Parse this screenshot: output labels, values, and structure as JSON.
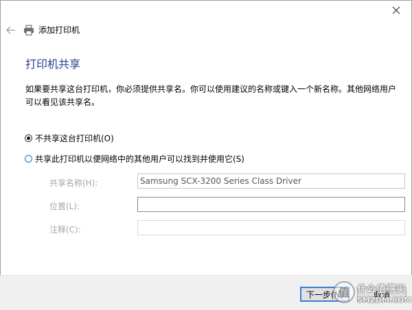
{
  "window": {
    "title": "添加打印机"
  },
  "page": {
    "heading": "打印机共享",
    "description": "如果要共享这台打印机，你必须提供共享名。你可以使用建议的名称或键入一个新名称。其他网络用户可以看见该共享名。"
  },
  "options": {
    "no_share": {
      "label": "不共享这台打印机(O)",
      "checked": true
    },
    "share": {
      "label": "共享此打印机以便网络中的其他用户可以找到并使用它(S)",
      "checked": false
    }
  },
  "fields": {
    "share_name": {
      "label": "共享名称(H):",
      "value": "Samsung SCX-3200 Series Class Driver"
    },
    "location": {
      "label": "位置(L):",
      "value": ""
    },
    "comment": {
      "label": "注释(C):",
      "value": ""
    }
  },
  "buttons": {
    "next": "下一步(N)",
    "cancel": "取消"
  },
  "watermark": {
    "line1": "什么值得买",
    "line2": "SMZDM.COM"
  },
  "icons": {
    "close": "close-icon",
    "back": "back-arrow-icon",
    "printer": "printer-icon"
  },
  "colors": {
    "heading": "#1c3f8f",
    "default_button_border": "#3a7bd5"
  }
}
